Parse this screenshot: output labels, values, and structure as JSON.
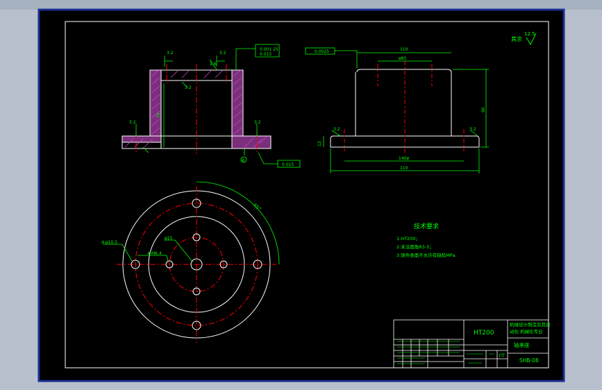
{
  "drawing": {
    "roughness_sym": "其余",
    "roughness_val": "12.5",
    "sec_flatness": "0.001 25",
    "sec_position": "0.015",
    "sec_runout": "0.015",
    "sec_rough_top1": "3.2",
    "sec_rough_top2": "3.2",
    "sec_rough_mid": "1.6",
    "sec_rough_inner": "3.2",
    "sec_rough_left": "3.2",
    "sec_rough_right": "3.2",
    "sec_dim_height": "76",
    "sec_datum": "A",
    "side_tol": "0.0025",
    "side_dim_top": "110",
    "side_dim_bore": "ø85",
    "side_dim_height": "90",
    "side_dim_flange": "12",
    "side_dim_pcd": "140ø",
    "side_dim_base": "110",
    "side_rough_left": "3.2",
    "side_rough_right": "3.2",
    "plan_hole_outer": "4-ø10.5",
    "plan_hole_inner": "4-M6.4",
    "plan_center": "ø15",
    "plan_angle": "45°"
  },
  "notes": {
    "title": "技术要求",
    "items": [
      "1.HT200；",
      "2.未注圆角R3-5；",
      "3.铸件表面不允许有缺陷MPa."
    ]
  },
  "title_block": {
    "material": "HT200",
    "org_line1": "机械设计制造及其自",
    "org_line2": "动化    机械化专业",
    "part_name": "轴承座",
    "drawing_no": "SHB-08",
    "scale": "1:1"
  },
  "colors": {
    "background": "#000000",
    "frame": "#ffffff",
    "centerline": "#ff0000",
    "dimension": "#00ff00",
    "hatch": "#cc44cc",
    "window": "#b7c0cc"
  }
}
